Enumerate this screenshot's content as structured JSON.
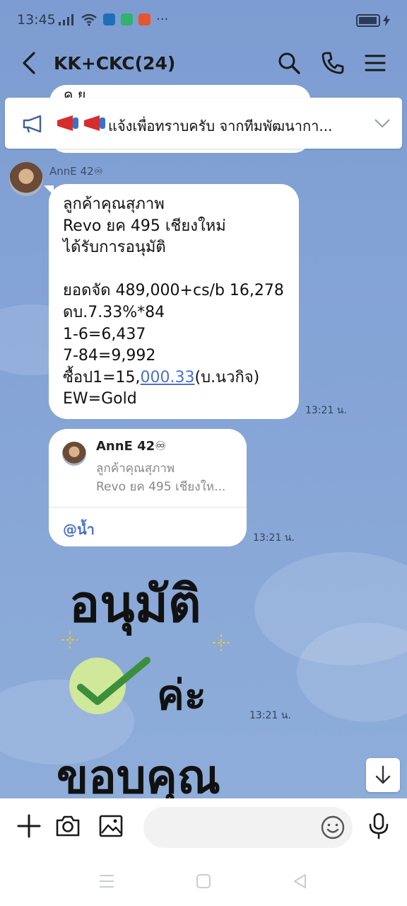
{
  "status": {
    "time": "13:45",
    "dots": "···"
  },
  "header": {
    "title": "KK+CKC(24)"
  },
  "announcement": {
    "text": "แจ้งเพื่อทราบครับ จากทีมพัฒนากา..."
  },
  "partial_message": {
    "text": "ค.ย..."
  },
  "message1": {
    "sender": "AnnE 42♾",
    "lines": [
      "ลูกค้าคุณสุภาพ",
      "Revo ยค 495 เชียงใหม่",
      "ได้รับการอนุมัติ",
      "",
      "ยอดจัด 489,000+cs/b 16,278",
      "ดบ.7.33%*84",
      "1-6=6,437",
      "7-84=9,992"
    ],
    "line9_before": "ซื้อป1=15,",
    "line9_link": "000.33",
    "line9_after": "(บ.นวกิจ)",
    "line10": "EW=Gold",
    "time": "13:21 น."
  },
  "message2": {
    "quote_name": "AnnE 42♾",
    "quote_line1": "ลูกค้าคุณสุภาพ",
    "quote_line2": "Revo ยค 495 เชียงให...",
    "mention": "@น้ำ",
    "time": "13:21 น."
  },
  "sticker": {
    "line1": "อนุมัติ",
    "line2": "ค่ะ",
    "line3": "ขอบคุณ",
    "time": "13:21 น."
  },
  "input": {
    "placeholder": ""
  },
  "colors": {
    "background": "#7f9ed2",
    "link": "#4a72c8",
    "check": "#3c8f3a",
    "check_circle": "#cfe89a"
  }
}
